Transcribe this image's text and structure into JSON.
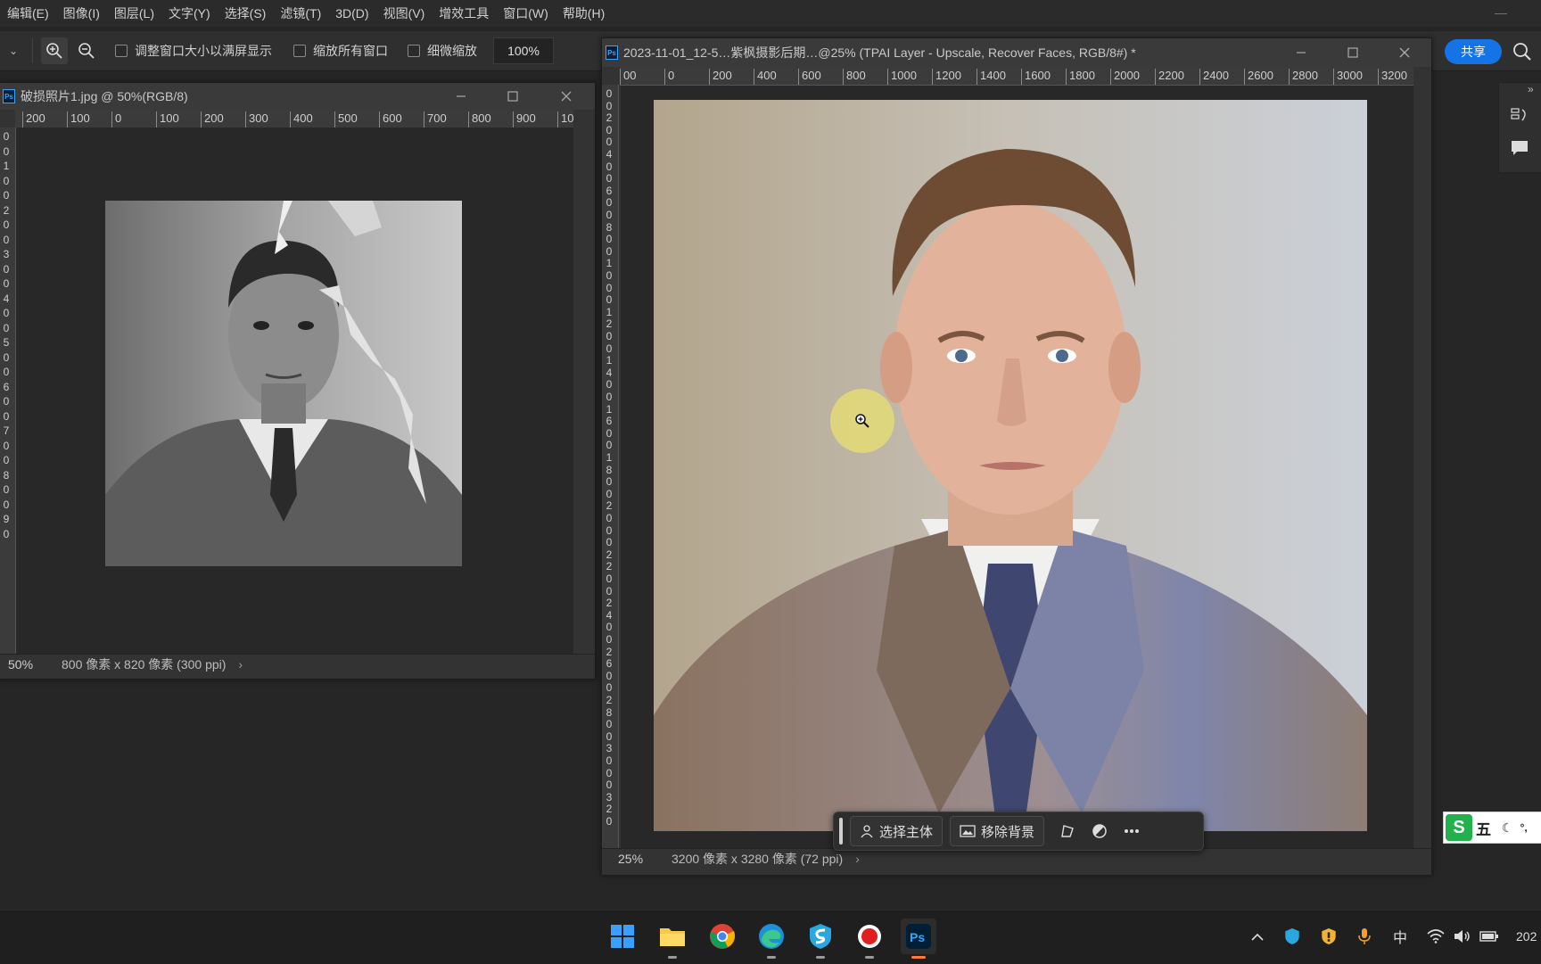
{
  "menubar": {
    "items": [
      "编辑(E)",
      "图像(I)",
      "图层(L)",
      "文字(Y)",
      "选择(S)",
      "滤镜(T)",
      "3D(D)",
      "视图(V)",
      "增效工具",
      "窗口(W)",
      "帮助(H)"
    ]
  },
  "optionsbar": {
    "resize_windows_label": "调整窗口大小以满屏显示",
    "zoom_all_windows_label": "缩放所有窗口",
    "scrubby_zoom_label": "细微缩放",
    "zoom_value": "100%",
    "share_label": "共享"
  },
  "left_doc": {
    "title": "破损照片1.jpg @ 50%(RGB/8)",
    "ruler_h": [
      "200",
      "100",
      "0",
      "100",
      "200",
      "300",
      "400",
      "500",
      "600",
      "700",
      "800",
      "900",
      "10"
    ],
    "ruler_v": [
      "0",
      "0",
      "1",
      "0",
      "0",
      "2",
      "0",
      "0",
      "3",
      "0",
      "0",
      "4",
      "0",
      "0",
      "5",
      "0",
      "0",
      "6",
      "0",
      "0",
      "7",
      "0",
      "0",
      "8",
      "0",
      "0",
      "9",
      "0"
    ],
    "status_zoom": "50%",
    "status_dims": "800 像素 x 820 像素 (300 ppi)"
  },
  "right_doc": {
    "title": "2023-11-01_12-5…紫枫摄影后期…@25% (TPAI Layer - Upscale, Recover Faces, RGB/8#) *",
    "ruler_h": [
      "00",
      "0",
      "200",
      "400",
      "600",
      "800",
      "1000",
      "1200",
      "1400",
      "1600",
      "1800",
      "2000",
      "2200",
      "2400",
      "2600",
      "2800",
      "3000",
      "3200"
    ],
    "ruler_v": [
      "0",
      "0",
      "2",
      "0",
      "0",
      "4",
      "0",
      "0",
      "6",
      "0",
      "0",
      "8",
      "0",
      "0",
      "1",
      "0",
      "0",
      "0",
      "1",
      "2",
      "0",
      "0",
      "1",
      "4",
      "0",
      "0",
      "1",
      "6",
      "0",
      "0",
      "1",
      "8",
      "0",
      "0",
      "2",
      "0",
      "0",
      "0",
      "2",
      "2",
      "0",
      "0",
      "2",
      "4",
      "0",
      "0",
      "2",
      "6",
      "0",
      "0",
      "2",
      "8",
      "0",
      "0",
      "3",
      "0",
      "0",
      "0",
      "3",
      "2",
      "0"
    ],
    "status_zoom": "25%",
    "status_dims": "3200 像素 x 3280 像素 (72 ppi)"
  },
  "context_bar": {
    "select_subject_label": "选择主体",
    "remove_bg_label": "移除背景"
  },
  "ime": {
    "mode": "五"
  },
  "taskbar": {
    "tray_lang": "中",
    "clock_partial": "202"
  },
  "colors": {
    "accent": "#1473e6",
    "ps_blue": "#31a8ff",
    "cursor_highlight": "#e8e070"
  }
}
